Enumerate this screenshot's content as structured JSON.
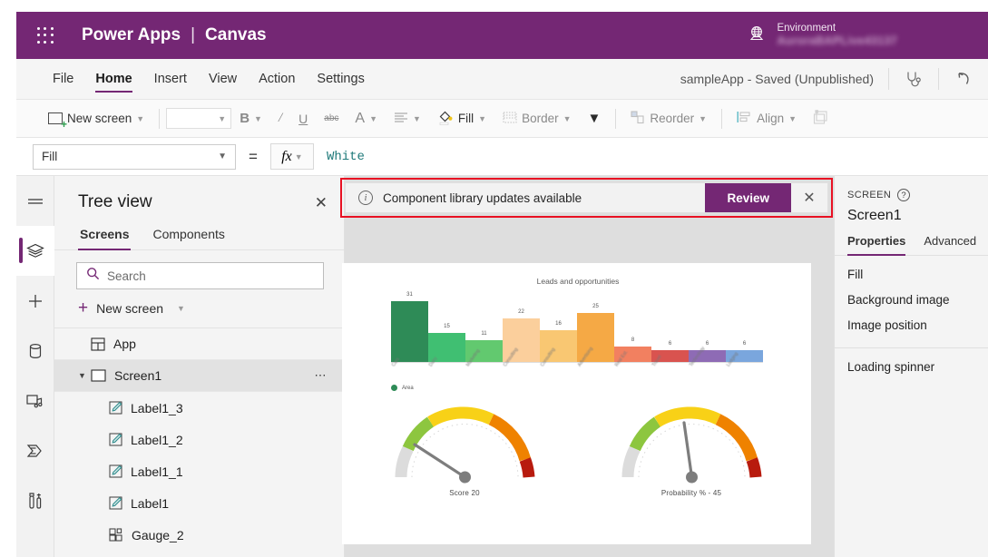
{
  "header": {
    "waffle_icon": "waffle-icon",
    "brand": "Power Apps",
    "separator": "|",
    "product": "Canvas",
    "globe_icon": "globe-icon",
    "environment_label": "Environment",
    "environment_value": "AuroraBAPLive43137",
    "brand_color": "#742774"
  },
  "menubar": {
    "items": [
      {
        "label": "File",
        "active": false
      },
      {
        "label": "Home",
        "active": true
      },
      {
        "label": "Insert",
        "active": false
      },
      {
        "label": "View",
        "active": false
      },
      {
        "label": "Action",
        "active": false
      },
      {
        "label": "Settings",
        "active": false
      }
    ],
    "save_status": "sampleApp - Saved (Unpublished)",
    "checker_icon": "stethoscope-icon",
    "undo_icon": "undo-icon"
  },
  "ribbon": {
    "new_screen": "New screen",
    "font_value": "",
    "bold": "B",
    "italic": "I",
    "underline": "U",
    "strikethrough": "abc",
    "font_color": "A",
    "align": "align-icon",
    "fill": "Fill",
    "border": "Border",
    "more": "chevron-down-icon",
    "reorder": "Reorder",
    "align_menu": "Align",
    "group": "group-icon"
  },
  "formula_bar": {
    "property": "Fill",
    "equals": "=",
    "fx": "fx",
    "value": "White"
  },
  "rail": {
    "items": [
      {
        "name": "hamburger-icon",
        "active": false
      },
      {
        "name": "tree-view-icon",
        "active": true
      },
      {
        "name": "insert-icon",
        "active": false
      },
      {
        "name": "data-icon",
        "active": false
      },
      {
        "name": "media-icon",
        "active": false
      },
      {
        "name": "power-automate-icon",
        "active": false
      },
      {
        "name": "variables-icon",
        "active": false
      }
    ]
  },
  "tree_view": {
    "title": "Tree view",
    "close_icon": "close-icon",
    "tabs": [
      {
        "label": "Screens",
        "active": true
      },
      {
        "label": "Components",
        "active": false
      }
    ],
    "search_placeholder": "Search",
    "search_icon": "search-icon",
    "new_screen": "New screen",
    "nodes": [
      {
        "label": "App",
        "icon": "app-icon",
        "level": 0,
        "selected": false,
        "expandable": false,
        "menu": false
      },
      {
        "label": "Screen1",
        "icon": "screen-icon",
        "level": 0,
        "selected": true,
        "expandable": true,
        "menu": true
      },
      {
        "label": "Label1_3",
        "icon": "label-icon",
        "level": 1,
        "selected": false,
        "expandable": false,
        "menu": false
      },
      {
        "label": "Label1_2",
        "icon": "label-icon",
        "level": 1,
        "selected": false,
        "expandable": false,
        "menu": false
      },
      {
        "label": "Label1_1",
        "icon": "label-icon",
        "level": 1,
        "selected": false,
        "expandable": false,
        "menu": false
      },
      {
        "label": "Label1",
        "icon": "label-icon",
        "level": 1,
        "selected": false,
        "expandable": false,
        "menu": false
      },
      {
        "label": "Gauge_2",
        "icon": "gauge-icon",
        "level": 1,
        "selected": false,
        "expandable": false,
        "menu": false
      }
    ]
  },
  "notification": {
    "info_icon": "info-icon",
    "message": "Component library updates available",
    "review_button": "Review",
    "close_icon": "close-icon",
    "highlight_color": "#e81123",
    "button_color": "#742774"
  },
  "properties_panel": {
    "kicker": "SCREEN",
    "help_icon": "help-icon",
    "name": "Screen1",
    "tabs": [
      {
        "label": "Properties",
        "active": true
      },
      {
        "label": "Advanced",
        "active": false
      }
    ],
    "rows": [
      "Fill",
      "Background image",
      "Image position"
    ],
    "rows_group2": [
      "Loading spinner"
    ]
  },
  "chart_data": [
    {
      "type": "bar",
      "title": "Leads and opportunities",
      "categories": [
        "Cars",
        "Dairy",
        "Marketing",
        "Consulting",
        "Consulting",
        "Advertising",
        "Real Est.",
        "Travel",
        "Technology",
        "Lodging"
      ],
      "values": [
        31,
        15,
        11,
        22,
        16,
        25,
        8,
        6,
        6,
        6
      ],
      "colors": [
        "#2e8b57",
        "#40bf72",
        "#62c96f",
        "#fbcf9c",
        "#f9c772",
        "#f5a945",
        "#f28060",
        "#d9534f",
        "#8e6bb5",
        "#7aa6dd"
      ],
      "legend": [
        "Area"
      ],
      "legend_color": "#2e8b57",
      "legend_position": "bottom-left",
      "xlabel": "",
      "ylabel": "",
      "ylim": [
        0,
        34
      ],
      "grid": false,
      "data_labels": true
    },
    {
      "type": "gauge",
      "title": "Score",
      "label": "Score    20",
      "value": 20,
      "min": 0,
      "max": 100,
      "bands": [
        {
          "color": "#dcdcdc",
          "from": 0,
          "to": 12
        },
        {
          "color": "#8dc63f",
          "from": 12,
          "to": 30
        },
        {
          "color": "#f8d117",
          "from": 30,
          "to": 58
        },
        {
          "color": "#ef8200",
          "from": 58,
          "to": 84
        },
        {
          "color": "#b81b0e",
          "from": 84,
          "to": 100
        }
      ],
      "needle_color": "#7d7d7d"
    },
    {
      "type": "gauge",
      "title": "Probability %",
      "label": "Probability % -  45",
      "value": 45,
      "min": 0,
      "max": 100,
      "bands": [
        {
          "color": "#dcdcdc",
          "from": 0,
          "to": 12
        },
        {
          "color": "#8dc63f",
          "from": 12,
          "to": 30
        },
        {
          "color": "#f8d117",
          "from": 30,
          "to": 58
        },
        {
          "color": "#ef8200",
          "from": 58,
          "to": 84
        },
        {
          "color": "#b81b0e",
          "from": 84,
          "to": 100
        }
      ],
      "needle_color": "#7d7d7d"
    }
  ]
}
